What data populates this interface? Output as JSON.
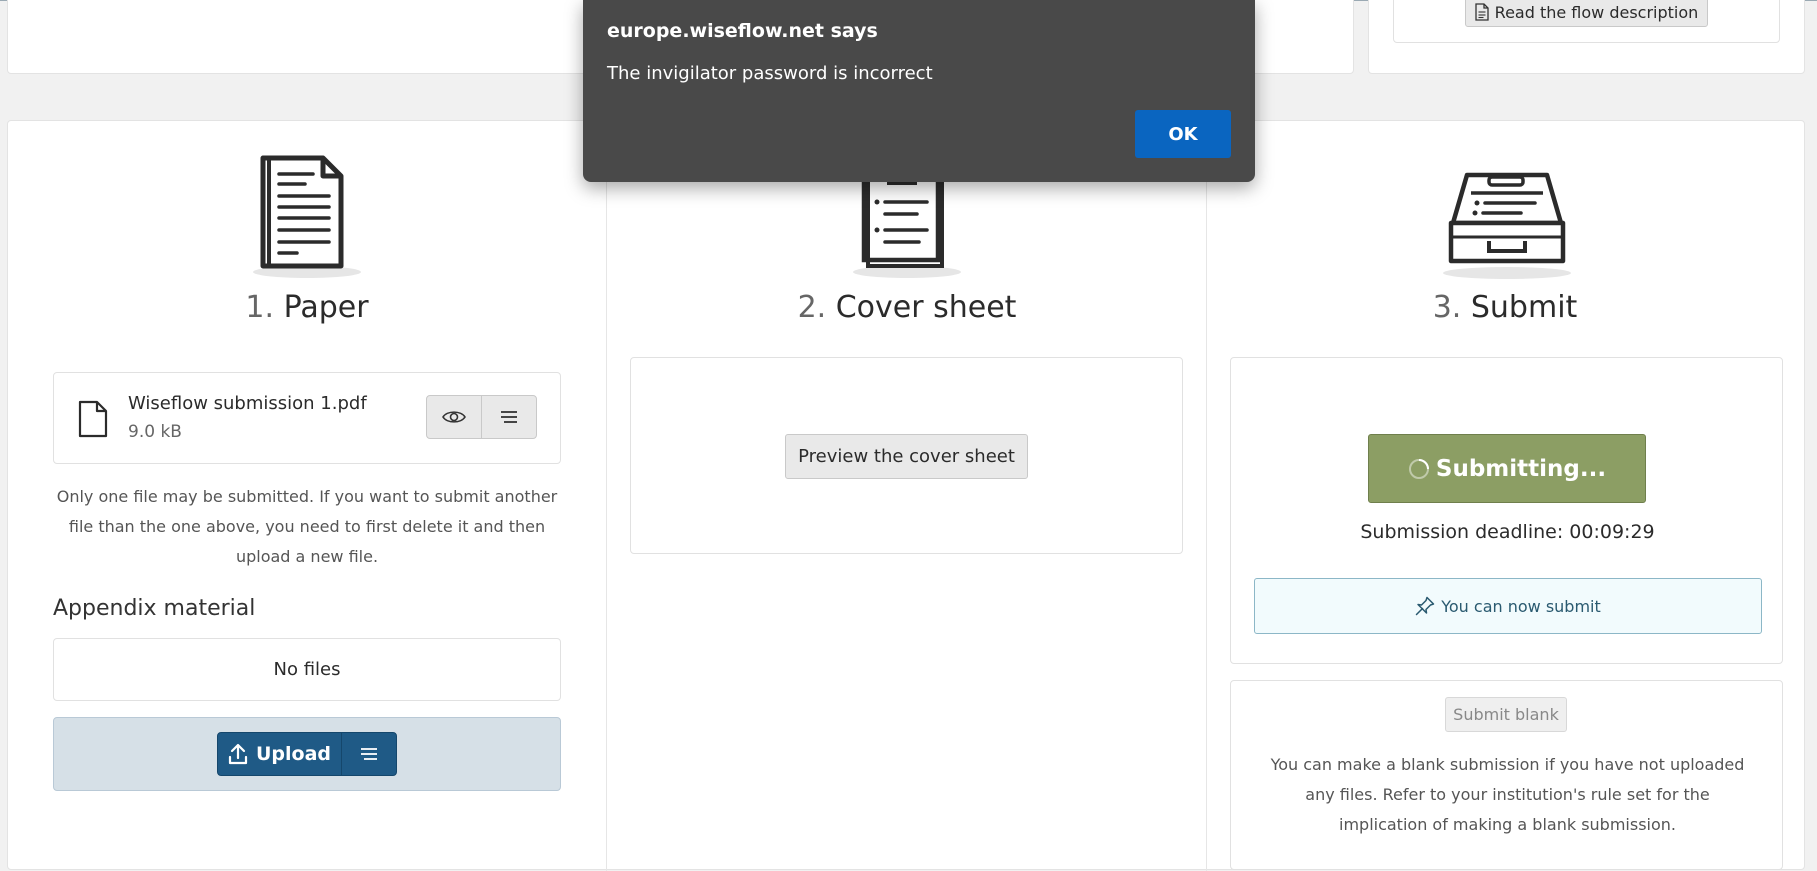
{
  "topbar": {
    "read_flow_label": "Read the flow description"
  },
  "dialog": {
    "title": "europe.wiseflow.net says",
    "message": "The invigilator password is incorrect",
    "ok_label": "OK"
  },
  "paper": {
    "number": "1.",
    "title": "Paper",
    "file_name": "Wiseflow submission 1.pdf",
    "file_size": "9.0 kB",
    "note": "Only one file may be submitted. If you want to submit another file than the one above, you need to first delete it and then upload a new file.",
    "appendix_heading": "Appendix material",
    "no_files": "No files",
    "upload_label": "Upload"
  },
  "cover": {
    "number": "2.",
    "title": "Cover sheet",
    "preview_label": "Preview the cover sheet"
  },
  "submit": {
    "number": "3.",
    "title": "Submit",
    "submitting_label": "Submitting...",
    "deadline": "Submission deadline: 00:09:29",
    "can_submit": "You can now submit",
    "submit_blank_label": "Submit blank",
    "blank_note": "You can make a blank submission if you have not uploaded any files. Refer to your institution's rule set for the implication of making a blank submission."
  },
  "colors": {
    "accent_blue": "#1f5a86",
    "submit_green": "#8c9e64",
    "dialog_bg": "#494949",
    "ok_blue": "#0a65c0"
  }
}
